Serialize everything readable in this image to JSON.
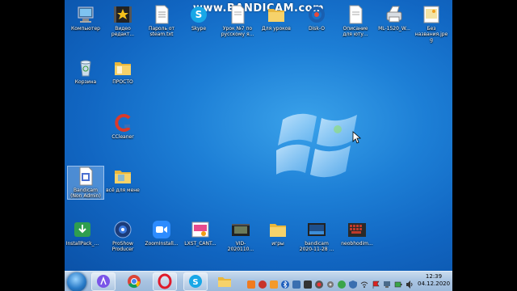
{
  "watermark": "www.BANDICAM.com",
  "desktop_icons": [
    {
      "id": "computer",
      "label": "Компьютер",
      "icon": "computer-icon"
    },
    {
      "id": "video-editor",
      "label": "Видео редакт...",
      "icon": "video-editor-icon"
    },
    {
      "id": "steam-password",
      "label": "Пароль от steam.txt",
      "icon": "text-file-icon"
    },
    {
      "id": "skype",
      "label": "Skype",
      "icon": "skype-icon"
    },
    {
      "id": "lesson7",
      "label": "Урок №7 по русскому я...",
      "icon": "document-icon"
    },
    {
      "id": "lessons",
      "label": "Для уроков",
      "icon": "folder-icon"
    },
    {
      "id": "disk-o",
      "label": "Disk-O",
      "icon": "disk-o-icon"
    },
    {
      "id": "youtube-desc",
      "label": "Описание для юту...",
      "icon": "document-icon"
    },
    {
      "id": "ml1520",
      "label": "ML-1520_W...",
      "icon": "printer-icon"
    },
    {
      "id": "untitled-jpeg",
      "label": "Без названия.jpeg",
      "icon": "image-file-icon"
    },
    {
      "id": "recycle-bin",
      "label": "Корзина",
      "icon": "recycle-bin-icon"
    },
    {
      "id": "prosto",
      "label": "ПРОСТО",
      "icon": "folder-icon"
    },
    {
      "id": "ccleaner",
      "label": "CCleaner",
      "icon": "ccleaner-icon"
    },
    {
      "id": "bandicam-nonadmin",
      "label": "Bandicam (Non Admin)",
      "icon": "bandicam-icon"
    },
    {
      "id": "all-for-mine",
      "label": "всё для мене",
      "icon": "folder-icon"
    },
    {
      "id": "installpack",
      "label": "InstallPack_...",
      "icon": "installpack-icon"
    },
    {
      "id": "proshow",
      "label": "ProShow Producer",
      "icon": "proshow-icon"
    },
    {
      "id": "zoominstall",
      "label": "ZoomInstall...",
      "icon": "zoom-icon"
    },
    {
      "id": "lxst-cant",
      "label": "LXST_CANT...",
      "icon": "audio-file-icon"
    },
    {
      "id": "vid-2020",
      "label": "VID-2020110...",
      "icon": "video-file-icon"
    },
    {
      "id": "games",
      "label": "игры",
      "icon": "folder-icon"
    },
    {
      "id": "bandicam-2020",
      "label": "bandicam 2020-11-28 ...",
      "icon": "video-file-icon"
    },
    {
      "id": "neobhodim",
      "label": "neobhodim...",
      "icon": "keyboard-icon"
    }
  ],
  "taskbar": {
    "items": [
      {
        "id": "start",
        "icon": "windows-start-icon"
      },
      {
        "id": "alice",
        "icon": "alice-icon"
      },
      {
        "id": "chrome",
        "icon": "chrome-icon"
      },
      {
        "id": "opera",
        "icon": "opera-icon"
      },
      {
        "id": "skype",
        "icon": "skype-icon"
      },
      {
        "id": "explorer",
        "icon": "folder-icon"
      }
    ],
    "clock_time": "12:39",
    "clock_date": "04.12.2020"
  },
  "colors": {
    "desktop_bg": "#1166c2",
    "taskbar_bg": "#a9c4e2",
    "folder": "#f3c54b"
  }
}
